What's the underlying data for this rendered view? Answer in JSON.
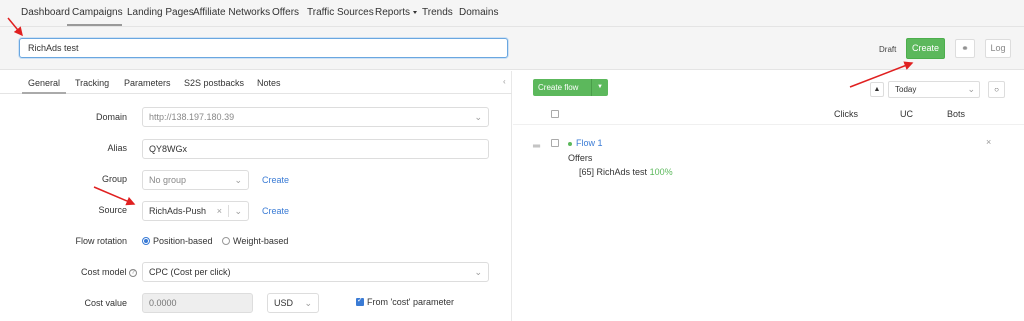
{
  "nav": {
    "items": [
      "Dashboard",
      "Campaigns",
      "Landing Pages",
      "Affiliate Networks",
      "Offers",
      "Traffic Sources",
      "Reports",
      "Trends",
      "Domains"
    ],
    "active": "Campaigns"
  },
  "header": {
    "campaign_name": "RichAds test",
    "status": "Draft",
    "create_label": "Create",
    "link_icon": "link-icon",
    "log_label": "Log"
  },
  "tabs": [
    "General",
    "Tracking",
    "Parameters",
    "S2S postbacks",
    "Notes"
  ],
  "form": {
    "domain_label": "Domain",
    "domain_value": "http://138.197.180.39",
    "alias_label": "Alias",
    "alias_value": "QY8WGx",
    "group_label": "Group",
    "group_value": "No group",
    "group_create": "Create",
    "source_label": "Source",
    "source_value": "RichAds-Push",
    "source_create": "Create",
    "flow_rotation_label": "Flow rotation",
    "rotation_position": "Position-based",
    "rotation_weight": "Weight-based",
    "cost_model_label": "Cost model",
    "cost_model_value": "CPC (Cost per click)",
    "cost_value_label": "Cost value",
    "cost_value_placeholder": "0.0000",
    "currency": "USD",
    "from_cost_label": "From 'cost' parameter",
    "from_cost_checked": true,
    "rotation_selected": "Position-based"
  },
  "flows": {
    "create_flow_label": "Create flow",
    "date_range": "Today",
    "columns": [
      "Clicks",
      "UC",
      "Bots"
    ],
    "items": [
      {
        "name": "Flow 1",
        "offers_label": "Offers",
        "offer_text": "[65] RichAds test",
        "offer_pct": "100%"
      }
    ]
  },
  "colors": {
    "accent_green": "#5cb85c",
    "link_blue": "#3a7bd5",
    "annotation_red": "#e02020"
  }
}
